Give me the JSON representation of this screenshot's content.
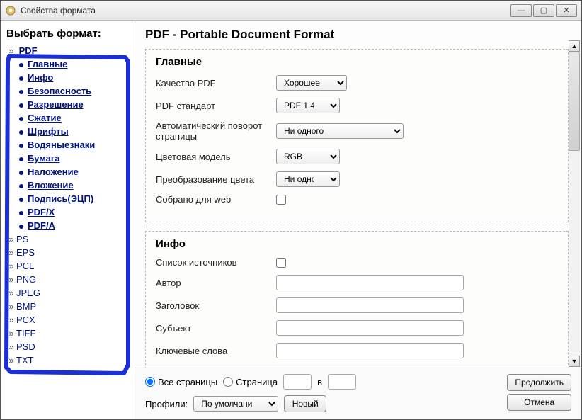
{
  "window": {
    "title": "Свойства формата"
  },
  "sidebar": {
    "heading": "Выбрать формат:",
    "formats_top": "PDF",
    "pdf_sub": [
      "Главные",
      "Инфо",
      "Безопасность",
      "Разрешение",
      "Сжатие",
      "Шрифты",
      "Водяныезнаки",
      "Бумага",
      "Наложение",
      "Вложение",
      "Подпись(ЭЦП)",
      "PDF/X",
      "PDF/A"
    ],
    "formats_rest": [
      "PS",
      "EPS",
      "PCL",
      "PNG",
      "JPEG",
      "BMP",
      "PCX",
      "TIFF",
      "PSD",
      "TXT"
    ]
  },
  "main": {
    "title": "PDF - Portable Document Format",
    "section_main": {
      "legend": "Главные",
      "quality": {
        "label": "Качество PDF",
        "value": "Хорошее"
      },
      "standard": {
        "label": "PDF стандарт",
        "value": "PDF 1.4"
      },
      "autorotate": {
        "label": "Автоматический поворот страницы",
        "value": "Ни одного"
      },
      "colormodel": {
        "label": "Цветовая модель",
        "value": "RGB"
      },
      "colortrans": {
        "label": "Преобразование цвета",
        "value": "Ни одного"
      },
      "webready": {
        "label": "Собрано для web"
      }
    },
    "section_info": {
      "legend": "Инфо",
      "sourcelist": "Список источников",
      "author": "Автор",
      "heading": "Заголовок",
      "subject": "Субъект",
      "keywords": "Ключевые слова"
    }
  },
  "footer": {
    "all_pages": "Все страницы",
    "page": "Страница",
    "page_in": "в",
    "profiles": "Профили:",
    "profile_value": "По умолчанию",
    "new": "Новый",
    "continue": "Продолжить",
    "cancel": "Отмена"
  }
}
